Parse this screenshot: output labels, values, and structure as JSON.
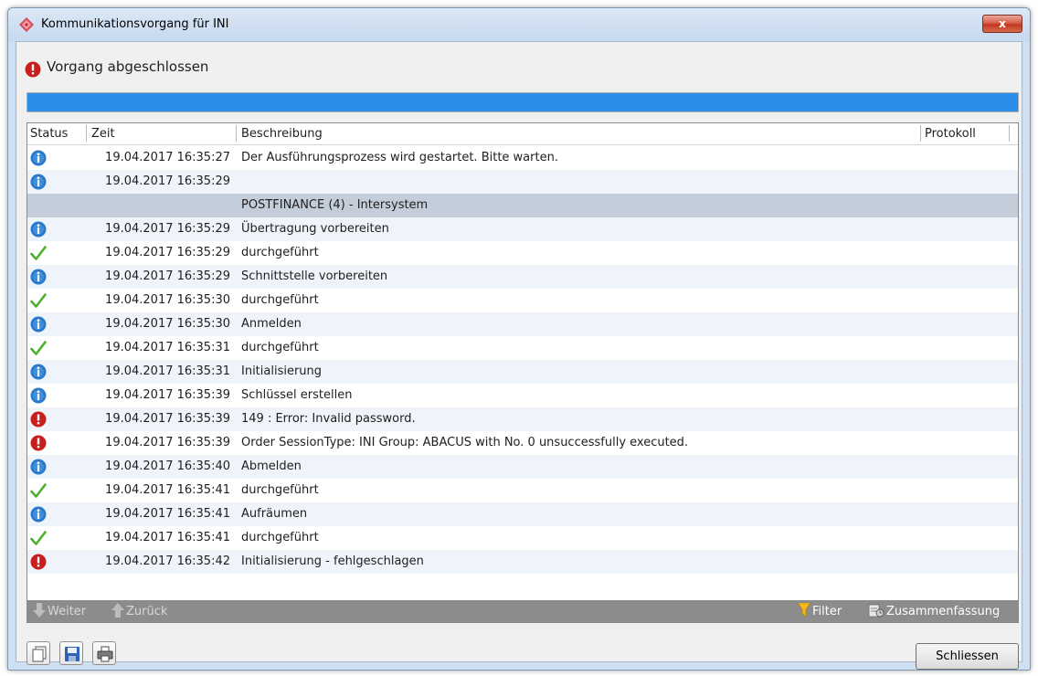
{
  "window": {
    "title": "Kommunikationsvorgang für INI",
    "close_label": "x"
  },
  "status": {
    "text": "Vorgang abgeschlossen",
    "icon": "error-icon"
  },
  "progress": {
    "value": 1.0,
    "color": "#2b8ee8"
  },
  "table": {
    "columns": [
      "Status",
      "Zeit",
      "Beschreibung",
      "Protokoll"
    ],
    "rows": [
      {
        "type": "info",
        "time": "19.04.2017 16:35:27",
        "desc": "Der Ausführungsprozess wird gestartet. Bitte warten."
      },
      {
        "type": "info",
        "time": "19.04.2017 16:35:29",
        "desc": ""
      },
      {
        "type": "group",
        "time": "",
        "desc": "POSTFINANCE (4) - Intersystem"
      },
      {
        "type": "info",
        "time": "19.04.2017 16:35:29",
        "desc": "Übertragung vorbereiten"
      },
      {
        "type": "ok",
        "time": "19.04.2017 16:35:29",
        "desc": "durchgeführt"
      },
      {
        "type": "info",
        "time": "19.04.2017 16:35:29",
        "desc": "Schnittstelle vorbereiten"
      },
      {
        "type": "ok",
        "time": "19.04.2017 16:35:30",
        "desc": "durchgeführt"
      },
      {
        "type": "info",
        "time": "19.04.2017 16:35:30",
        "desc": "Anmelden"
      },
      {
        "type": "ok",
        "time": "19.04.2017 16:35:31",
        "desc": "durchgeführt"
      },
      {
        "type": "info",
        "time": "19.04.2017 16:35:31",
        "desc": "Initialisierung"
      },
      {
        "type": "info",
        "time": "19.04.2017 16:35:39",
        "desc": "Schlüssel erstellen"
      },
      {
        "type": "error",
        "time": "19.04.2017 16:35:39",
        "desc": "149 : Error: Invalid password."
      },
      {
        "type": "error",
        "time": "19.04.2017 16:35:39",
        "desc": "Order SessionType: INI Group: ABACUS with No. 0 unsuccessfully executed."
      },
      {
        "type": "info",
        "time": "19.04.2017 16:35:40",
        "desc": "Abmelden"
      },
      {
        "type": "ok",
        "time": "19.04.2017 16:35:41",
        "desc": "durchgeführt"
      },
      {
        "type": "info",
        "time": "19.04.2017 16:35:41",
        "desc": "Aufräumen"
      },
      {
        "type": "ok",
        "time": "19.04.2017 16:35:41",
        "desc": "durchgeführt"
      },
      {
        "type": "error",
        "time": "19.04.2017 16:35:42",
        "desc": "Initialisierung - fehlgeschlagen"
      }
    ]
  },
  "navbar": {
    "next_label": "Weiter",
    "prev_label": "Zurück",
    "filter_label": "Filter",
    "summary_label": "Zusammenfassung"
  },
  "toolbar": {
    "copy_icon": "copy-icon",
    "save_icon": "save-icon",
    "print_icon": "print-icon"
  },
  "buttons": {
    "close_label": "Schliessen"
  },
  "colors": {
    "info": "#2a78c8",
    "ok": "#4caf2e",
    "error": "#c81e1e",
    "group_row": "#c4cdda",
    "accent": "#2b8ee8"
  }
}
